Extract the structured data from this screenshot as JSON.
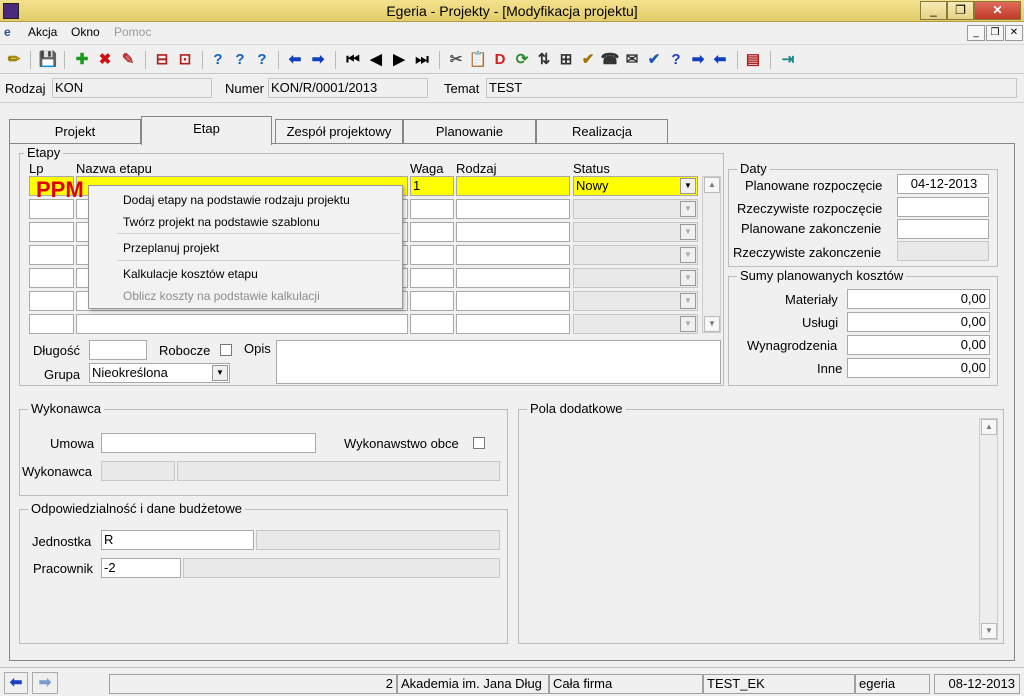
{
  "window": {
    "title": "Egeria - Projekty - [Modyfikacja projektu]",
    "min": "_",
    "max": "❐",
    "close": "✕"
  },
  "menu": {
    "items": [
      "Akcja",
      "Okno",
      "Pomoc"
    ]
  },
  "mdi": {
    "min": "_",
    "restore": "❐",
    "close": "✕"
  },
  "toolbar": {
    "icons": [
      "✏",
      "💾",
      "✚",
      "✖",
      "✎",
      "⊟",
      "⊡",
      "?",
      "?",
      "?",
      "⬅",
      "➡",
      "⏮",
      "◀",
      "▶",
      "⏭",
      "✂",
      "📋",
      "D",
      "⟳",
      "⇅",
      "⊞",
      "✔",
      "☎",
      "✉",
      "✔",
      "?",
      "➡",
      "⬅",
      "▤",
      "⇥"
    ]
  },
  "header": {
    "rodzaj_label": "Rodzaj",
    "rodzaj_value": "KON",
    "numer_label": "Numer",
    "numer_value": "KON/R/0001/2013",
    "temat_label": "Temat",
    "temat_value": "TEST"
  },
  "tabs": [
    "Projekt",
    "Etap",
    "Zespół projektowy",
    "Planowanie",
    "Realizacja"
  ],
  "etapy": {
    "group_title": "Etapy",
    "col_lp": "Lp",
    "col_nazwa": "Nazwa etapu",
    "col_waga": "Waga",
    "col_rodzaj": "Rodzaj",
    "col_status": "Status",
    "row1_waga": "1",
    "row1_status": "Nowy",
    "ppm": "PPM"
  },
  "context_menu": {
    "items": [
      "Dodaj etapy na podstawie rodzaju projektu",
      "Twórz projekt na podstawie szablonu",
      "Przeplanuj projekt",
      "Kalkulacje kosztów etapu",
      "Oblicz koszty na podstawie kalkulacji"
    ]
  },
  "daty": {
    "title": "Daty",
    "planowane_rozpoczecie_label": "Planowane rozpoczęcie",
    "planowane_rozpoczecie_value": "04-12-2013",
    "rzeczywiste_rozpoczecie_label": "Rzeczywiste rozpoczęcie",
    "planowane_zakonczenie_label": "Planowane zakonczenie",
    "rzeczywiste_zakonczenie_label": "Rzeczywiste zakonczenie"
  },
  "sumy": {
    "title": "Sumy planowanych kosztów",
    "materialy_label": "Materiały",
    "materialy_value": "0,00",
    "uslugi_label": "Usługi",
    "uslugi_value": "0,00",
    "wynagrodzenia_label": "Wynagrodzenia",
    "wynagrodzenia_value": "0,00",
    "inne_label": "Inne",
    "inne_value": "0,00"
  },
  "details": {
    "dlugosc_label": "Długość",
    "robocze_label": "Robocze",
    "opis_label": "Opis",
    "grupa_label": "Grupa",
    "grupa_value": "Nieokreślona"
  },
  "wykonawca": {
    "title": "Wykonawca",
    "umowa_label": "Umowa",
    "wykonawstwo_label": "Wykonawstwo obce",
    "wykonawca_label": "Wykonawca"
  },
  "pola": {
    "title": "Pola dodatkowe"
  },
  "odp": {
    "title": "Odpowiedzialność i dane budżetowe",
    "jednostka_label": "Jednostka",
    "jednostka_value": "R",
    "pracownik_label": "Pracownik",
    "pracownik_value": "-2"
  },
  "statusbar": {
    "num": "2",
    "org": "Akademia im. Jana Dług",
    "firma": "Cała firma",
    "user": "TEST_EK",
    "app": "egeria",
    "date": "08-12-2013"
  }
}
